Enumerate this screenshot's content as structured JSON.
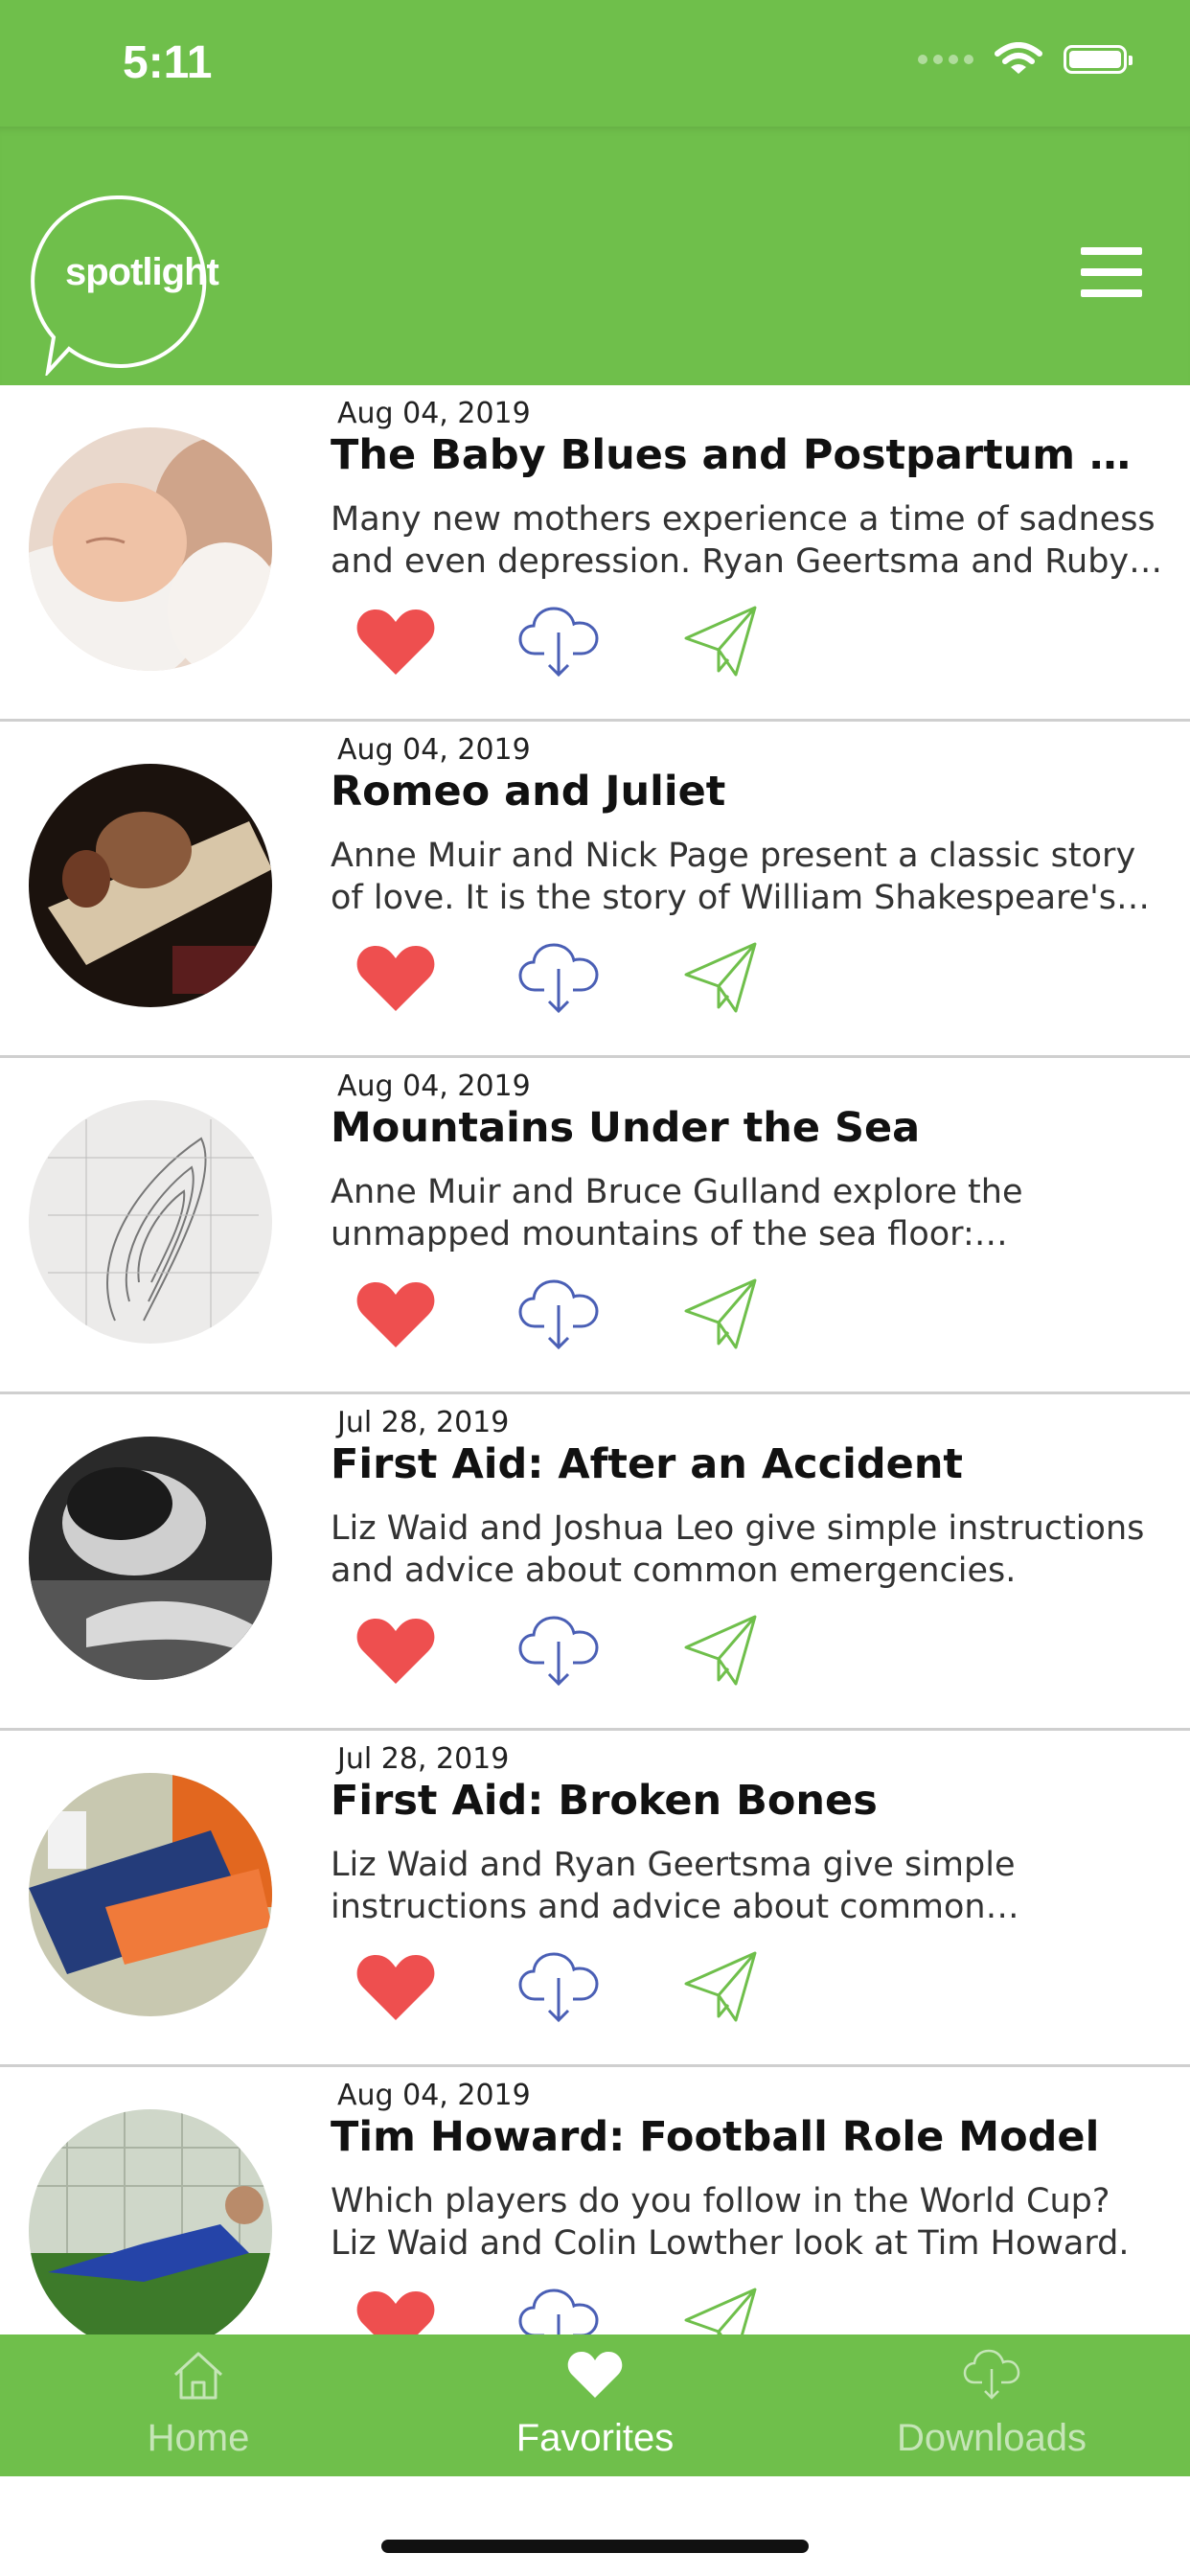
{
  "status_bar": {
    "time": "5:11"
  },
  "header": {
    "logo_text": "spotlight",
    "brand_color": "#6fbf4b"
  },
  "articles": [
    {
      "date": "Aug 04, 2019",
      "title": "The Baby Blues and Postpartum Depression",
      "description": "Many new mothers experience a time of sadness and even depression. Ryan Geertsma and Ruby Keller discuss the baby blues and postpartum depression.",
      "thumbnail": "newborn baby sleeping"
    },
    {
      "date": "Aug 04, 2019",
      "title": "Romeo and Juliet",
      "description": "Anne Muir and Nick Page present a classic story of love. It is the story of William Shakespeare's Romeo and Juliet.",
      "thumbnail": "theatre stage scene"
    },
    {
      "date": "Aug 04, 2019",
      "title": "Mountains Under the Sea",
      "description": "Anne Muir and Bruce Gulland explore the unmapped mountains of the sea floor: seamounts.",
      "thumbnail": "sea floor contour map"
    },
    {
      "date": "Jul 28, 2019",
      "title": "First Aid: After an Accident",
      "description": "Liz Waid and Joshua Leo give simple instructions and advice about common emergencies.",
      "thumbnail": "person lying on ground"
    },
    {
      "date": "Jul 28, 2019",
      "title": "First Aid: Broken Bones",
      "description": "Liz Waid and Ryan Geertsma give simple instructions and advice about common emergencies.",
      "thumbnail": "leg in orange cast"
    },
    {
      "date": "Aug 04, 2019",
      "title": "Tim Howard: Football Role Model",
      "description": "Which players do you follow in the World Cup? Liz Waid and Colin Lowther look at Tim Howard.",
      "thumbnail": "goalkeeper diving"
    }
  ],
  "action_icons": {
    "favorite": "heart-icon",
    "download": "cloud-download-icon",
    "share": "paper-plane-icon"
  },
  "colors": {
    "heart": "#ee4f4f",
    "download": "#4a5fb5",
    "share": "#6fbf4b"
  },
  "tabs": [
    {
      "label": "Home",
      "icon": "house-icon",
      "active": false
    },
    {
      "label": "Favorites",
      "icon": "heart-icon",
      "active": true
    },
    {
      "label": "Downloads",
      "icon": "cloud-download-icon",
      "active": false
    }
  ]
}
